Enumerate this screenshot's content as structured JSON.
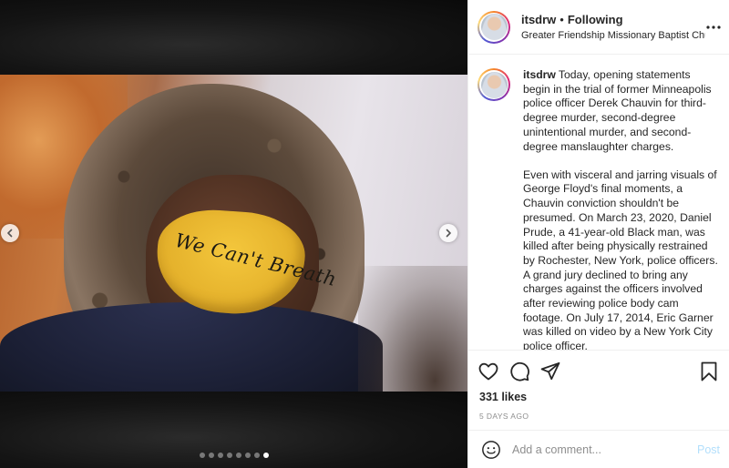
{
  "post": {
    "username": "itsdrw",
    "separator": "•",
    "follow_status": "Following",
    "location": "Greater Friendship Missionary Baptist Church",
    "more_icon": "more-horizontal-icon",
    "image": {
      "mask_text": "We Can't Breath",
      "carousel": {
        "total": 8,
        "active_index": 7
      }
    },
    "caption": {
      "username": "itsdrw",
      "paragraph1": "Today, opening statements begin in the trial of former Minneapolis police officer Derek Chauvin for third-degree murder, second-degree unintentional murder, and second-degree manslaughter charges.",
      "paragraph2": "Even with visceral and jarring visuals of George Floyd's final moments, a Chauvin conviction shouldn't be presumed. On March 23, 2020, Daniel Prude, a 41-year-old Black man, was killed after being physically restrained by Rochester, New York, police officers. A grand jury declined to bring any charges against the officers involved after reviewing police body cam footage. On July 17, 2014, Eric Garner was killed on video by a New York City police officer."
    },
    "actions": {
      "like_icon": "heart-icon",
      "comment_icon": "comment-bubble-icon",
      "share_icon": "paper-plane-icon",
      "save_icon": "bookmark-icon"
    },
    "likes": "331 likes",
    "timestamp": "5 DAYS AGO",
    "comment": {
      "emoji_icon": "smiley-icon",
      "placeholder": "Add a comment...",
      "value": "",
      "post_label": "Post"
    }
  }
}
